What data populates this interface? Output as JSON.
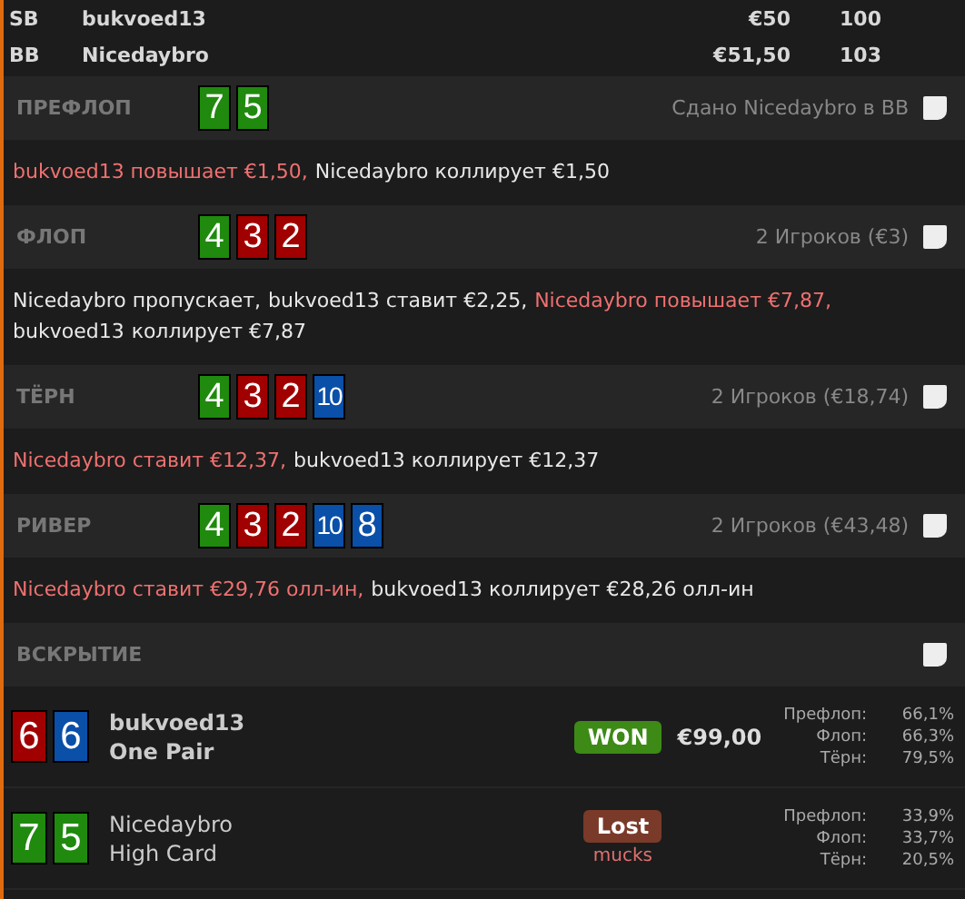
{
  "players": [
    {
      "position": "SB",
      "name": "bukvoed13",
      "stack": "€50",
      "bb": "100"
    },
    {
      "position": "BB",
      "name": "Nicedaybro",
      "stack": "€51,50",
      "bb": "103"
    }
  ],
  "streets": [
    {
      "title": "ПРЕФЛОП",
      "cards": [
        {
          "rank": "7",
          "color": "#1f8a0e"
        },
        {
          "rank": "5",
          "color": "#1f8a0e"
        }
      ],
      "info": "Сдано Nicedaybro в BB",
      "actions": [
        {
          "text": "bukvoed13 повышает €1,50,",
          "highlight": true
        },
        {
          "text": "Nicedaybro коллирует €1,50",
          "highlight": false
        }
      ]
    },
    {
      "title": "ФЛОП",
      "cards": [
        {
          "rank": "4",
          "color": "#1f8a0e"
        },
        {
          "rank": "3",
          "color": "#a00000"
        },
        {
          "rank": "2",
          "color": "#a00000"
        }
      ],
      "info": "2 Игроков (€3)",
      "actions": [
        {
          "text": "Nicedaybro пропускает,",
          "highlight": false
        },
        {
          "text": "bukvoed13 ставит €2,25,",
          "highlight": false
        },
        {
          "text": "Nicedaybro повышает €7,87,",
          "highlight": true
        },
        {
          "text": "bukvoed13",
          "highlight": false
        },
        {
          "text": "коллирует €7,87",
          "highlight": false
        }
      ]
    },
    {
      "title": "ТЁРН",
      "cards": [
        {
          "rank": "4",
          "color": "#1f8a0e"
        },
        {
          "rank": "3",
          "color": "#a00000"
        },
        {
          "rank": "2",
          "color": "#a00000"
        },
        {
          "rank": "10",
          "color": "#0a4fa8"
        }
      ],
      "info": "2 Игроков (€18,74)",
      "actions": [
        {
          "text": "Nicedaybro ставит €12,37,",
          "highlight": true
        },
        {
          "text": "bukvoed13 коллирует €12,37",
          "highlight": false
        }
      ]
    },
    {
      "title": "РИВЕР",
      "cards": [
        {
          "rank": "4",
          "color": "#1f8a0e"
        },
        {
          "rank": "3",
          "color": "#a00000"
        },
        {
          "rank": "2",
          "color": "#a00000"
        },
        {
          "rank": "10",
          "color": "#0a4fa8"
        },
        {
          "rank": "8",
          "color": "#0a4fa8"
        }
      ],
      "info": "2 Игроков (€43,48)",
      "actions": [
        {
          "text": "Nicedaybro ставит €29,76 олл-ин,",
          "highlight": true
        },
        {
          "text": "bukvoed13 коллирует €28,26 олл-ин",
          "highlight": false
        }
      ]
    }
  ],
  "showdown": {
    "title": "ВСКРЫТИЕ",
    "hands": [
      {
        "cards": [
          {
            "rank": "6",
            "color": "#a00000"
          },
          {
            "rank": "6",
            "color": "#0a4fa8"
          }
        ],
        "name": "bukvoed13",
        "hand": "One Pair",
        "result": {
          "kind": "won",
          "label": "WON",
          "amount": "€99,00"
        },
        "equity": [
          {
            "street": "Префлоп:",
            "value": "66,1%"
          },
          {
            "street": "Флоп:",
            "value": "66,3%"
          },
          {
            "street": "Тёрн:",
            "value": "79,5%"
          }
        ]
      },
      {
        "cards": [
          {
            "rank": "7",
            "color": "#1f8a0e"
          },
          {
            "rank": "5",
            "color": "#1f8a0e"
          }
        ],
        "name": "Nicedaybro",
        "hand": "High Card",
        "result": {
          "kind": "lost",
          "label": "Lost",
          "note": "mucks"
        },
        "equity": [
          {
            "street": "Префлоп:",
            "value": "33,9%"
          },
          {
            "street": "Флоп:",
            "value": "33,7%"
          },
          {
            "street": "Тёрн:",
            "value": "20,5%"
          }
        ]
      }
    ]
  }
}
